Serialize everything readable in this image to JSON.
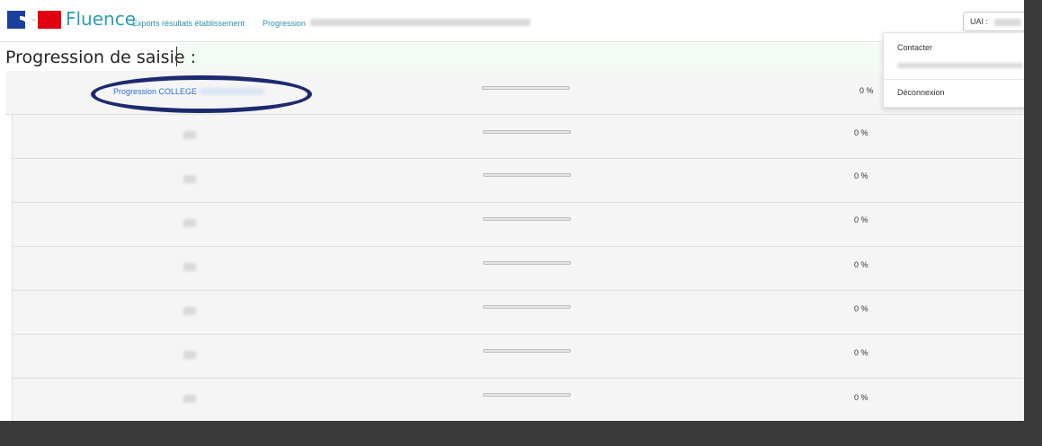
{
  "header": {
    "brand": "Fluence",
    "nav_links": [
      "Exports résultats établissement",
      "Progression"
    ],
    "uai_label": "UAI :"
  },
  "user_menu": {
    "items": [
      "Contacter",
      "Déconnexion"
    ]
  },
  "page": {
    "title": "Progression de saisie :"
  },
  "rows": [
    {
      "label": "Progression COLLEGE",
      "progress": 0,
      "percent": "0 %"
    },
    {
      "label": "",
      "progress": 0,
      "percent": "0 %"
    },
    {
      "label": "",
      "progress": 0,
      "percent": "0 %"
    },
    {
      "label": "",
      "progress": 0,
      "percent": "0 %"
    },
    {
      "label": "",
      "progress": 0,
      "percent": "0 %"
    },
    {
      "label": "",
      "progress": 0,
      "percent": "0 %"
    },
    {
      "label": "",
      "progress": 0,
      "percent": "0 %"
    },
    {
      "label": "",
      "progress": 0,
      "percent": "0 %"
    }
  ],
  "colors": {
    "brand": "#2f9bb8",
    "link": "#2a6fcf",
    "annotation": "#1e2a6e"
  }
}
